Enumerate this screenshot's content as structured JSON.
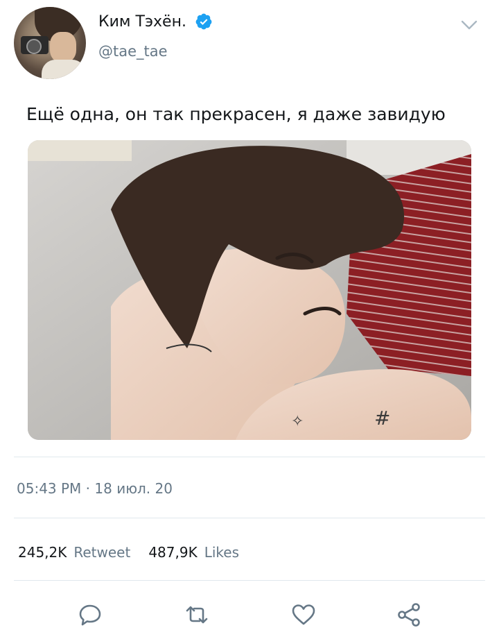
{
  "author": {
    "name": "Ким Тэхён.",
    "handle": "@tae_tae",
    "verified": true
  },
  "tweet": {
    "text": "Ещё одна, он так прекрасен, я даже завидую"
  },
  "meta": {
    "timestamp": "05:43 PM · 18 июл. 20"
  },
  "stats": {
    "retweets_count": "245,2K",
    "retweets_label": "Retweet",
    "likes_count": "487,9K",
    "likes_label": "Likes"
  },
  "actions": [
    "reply-icon",
    "retweet-icon",
    "like-icon",
    "share-icon"
  ],
  "colors": {
    "accent": "#1da1f2",
    "secondary_text": "#657786",
    "divider": "#e1e8ed"
  }
}
